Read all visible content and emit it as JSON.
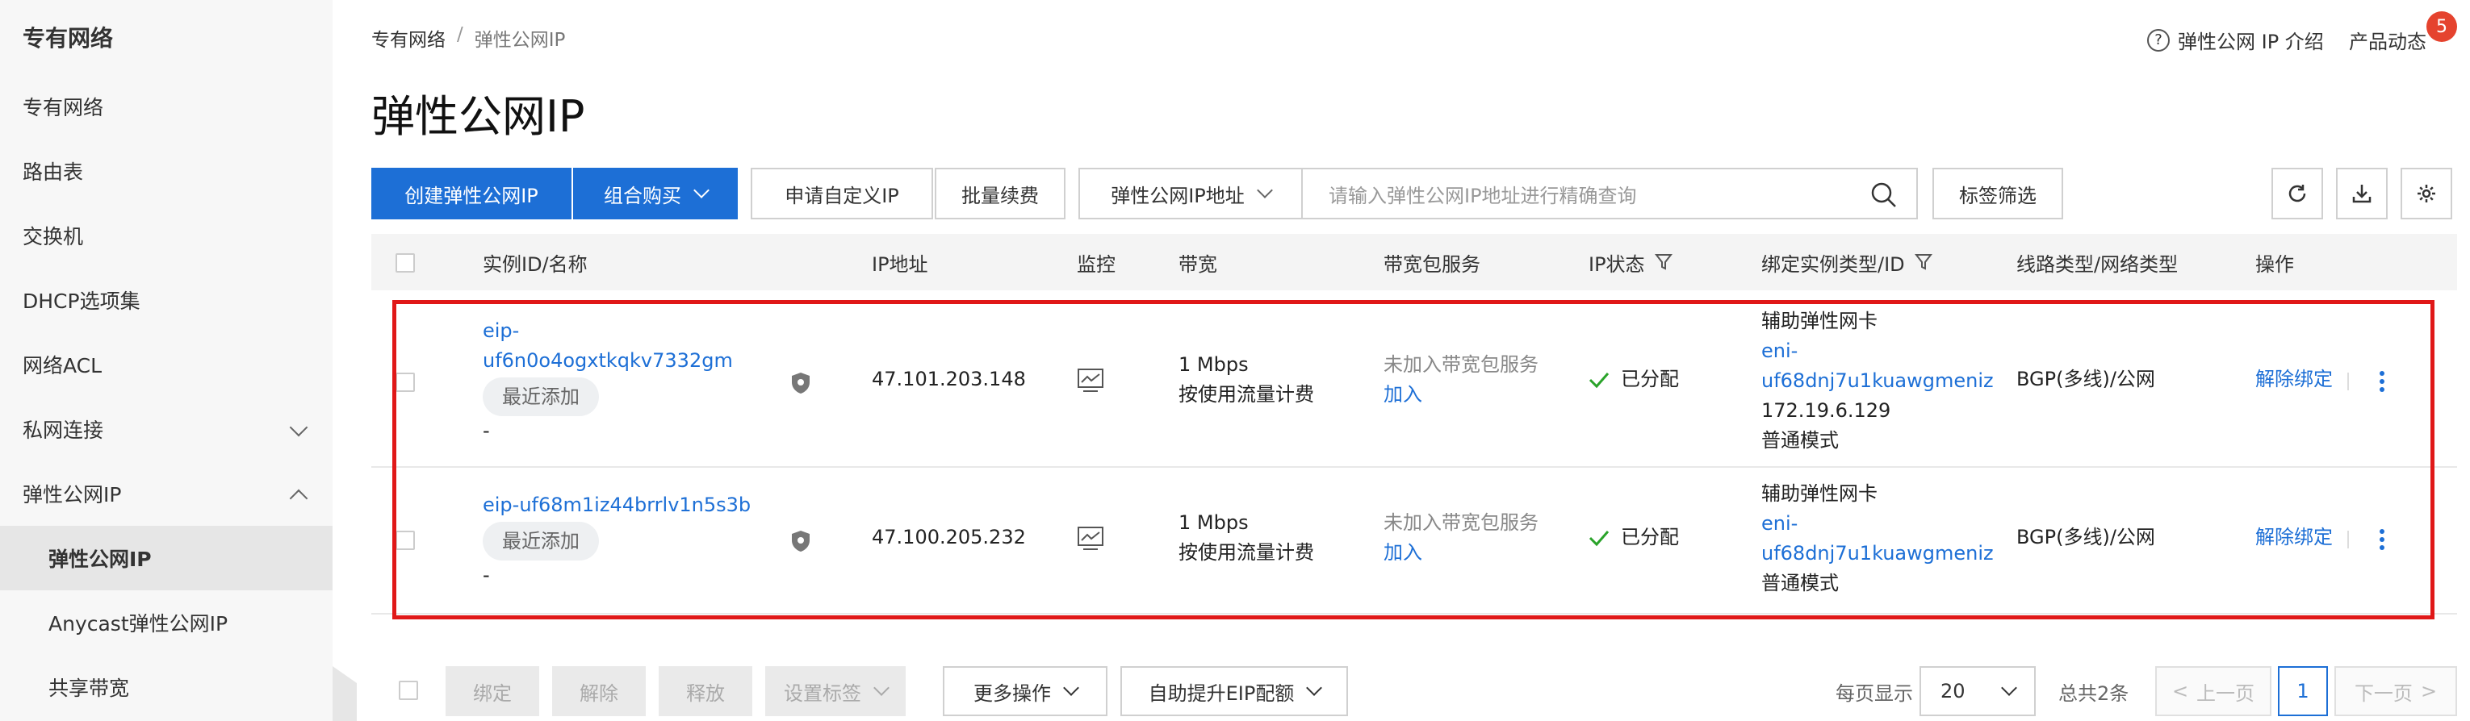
{
  "sidebar": {
    "title": "专有网络",
    "items": [
      {
        "label": "专有网络"
      },
      {
        "label": "路由表"
      },
      {
        "label": "交换机"
      },
      {
        "label": "DHCP选项集"
      },
      {
        "label": "网络ACL"
      },
      {
        "label": "私网连接"
      },
      {
        "label": "弹性公网IP"
      },
      {
        "label": "弹性公网IP"
      },
      {
        "label": "Anycast弹性公网IP"
      },
      {
        "label": "共享带宽"
      }
    ]
  },
  "breadcrumb": {
    "root": "专有网络",
    "sep": "/",
    "current": "弹性公网IP"
  },
  "page_title": "弹性公网IP",
  "header": {
    "help_label": "弹性公网 IP 介绍",
    "help_icon": "?",
    "news_label": "产品动态",
    "news_count": "5"
  },
  "toolbar": {
    "create": "创建弹性公网IP",
    "combo": "组合购买",
    "apply_custom": "申请自定义IP",
    "batch_renew": "批量续费",
    "search_field": "弹性公网IP地址",
    "search_placeholder": "请输入弹性公网IP地址进行精确查询",
    "tag_filter": "标签筛选"
  },
  "table": {
    "headers": {
      "instance": "实例ID/名称",
      "ip": "IP地址",
      "monitor": "监控",
      "bandwidth": "带宽",
      "package": "带宽包服务",
      "status": "IP状态",
      "bound": "绑定实例类型/ID",
      "line": "线路类型/网络类型",
      "ops": "操作"
    },
    "rows": [
      {
        "id_line1": "eip-",
        "id_line2": "uf6n0o4ogxtkqkv7332gm",
        "tag": "最近添加",
        "name": "-",
        "ip": "47.101.203.148",
        "bandwidth": "1 Mbps",
        "billing": "按使用流量计费",
        "package_status": "未加入带宽包服务",
        "package_action": "加入",
        "status": "已分配",
        "bound_type": "辅助弹性网卡",
        "bound_id_line1": "eni-",
        "bound_id_line2": "uf68dnj7u1kuawgmeniz",
        "bound_ip": "172.19.6.129",
        "bound_mode": "普通模式",
        "line": "BGP(多线)/公网",
        "op": "解除绑定"
      },
      {
        "id_line1": "eip-uf68m1iz44brrlv1n5s3b",
        "tag": "最近添加",
        "name": "-",
        "ip": "47.100.205.232",
        "bandwidth": "1 Mbps",
        "billing": "按使用流量计费",
        "package_status": "未加入带宽包服务",
        "package_action": "加入",
        "status": "已分配",
        "bound_type": "辅助弹性网卡",
        "bound_id_line1": "eni-",
        "bound_id_line2": "uf68dnj7u1kuawgmeniz",
        "bound_mode": "普通模式",
        "line": "BGP(多线)/公网",
        "op": "解除绑定"
      }
    ]
  },
  "footer": {
    "bind": "绑定",
    "unbind": "解除",
    "release": "释放",
    "set_tags": "设置标签",
    "more_ops": "更多操作",
    "auto_quota": "自助提升EIP配额",
    "page_size_label": "每页显示",
    "page_size": "20",
    "total": "总共2条",
    "prev": "上一页",
    "page": "1",
    "next": "下一页"
  },
  "colors": {
    "primary": "#1d6fd6",
    "highlight": "#e01818",
    "success": "#2aa32a",
    "badge": "#e5432e"
  }
}
